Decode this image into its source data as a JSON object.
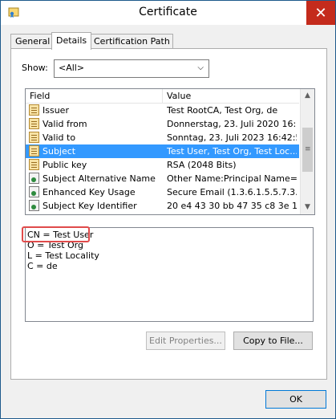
{
  "window": {
    "title": "Certificate",
    "close_glyph": "✕"
  },
  "tabs": [
    {
      "label": "General"
    },
    {
      "label": "Details"
    },
    {
      "label": "Certification Path"
    }
  ],
  "details": {
    "show_label": "Show:",
    "show_value": "<All>",
    "columns": {
      "field": "Field",
      "value": "Value"
    },
    "rows": [
      {
        "field": "Issuer",
        "value": "Test RootCA, Test Org, de",
        "icon": "certificate-field-icon"
      },
      {
        "field": "Valid from",
        "value": "Donnerstag, 23. Juli 2020 16:...",
        "icon": "certificate-field-icon"
      },
      {
        "field": "Valid to",
        "value": "Sonntag, 23. Juli 2023 16:42:56",
        "icon": "certificate-field-icon"
      },
      {
        "field": "Subject",
        "value": "Test User, Test Org, Test Loc...",
        "icon": "certificate-field-icon",
        "selected": true
      },
      {
        "field": "Public key",
        "value": "RSA (2048 Bits)",
        "icon": "certificate-field-icon"
      },
      {
        "field": "Subject Alternative Name",
        "value": "Other Name:Principal Name=t...",
        "icon": "extension-icon"
      },
      {
        "field": "Enhanced Key Usage",
        "value": "Secure Email (1.3.6.1.5.5.7.3....",
        "icon": "extension-icon"
      },
      {
        "field": "Subject Key Identifier",
        "value": "20 e4 43 30 bb 47 35 c8 3e 17...",
        "icon": "extension-icon"
      }
    ],
    "detail_lines": [
      "CN = Test User",
      "O = Test Org",
      "L = Test Locality",
      "C = de"
    ],
    "edit_properties_label": "Edit Properties...",
    "copy_to_file_label": "Copy to File..."
  },
  "ok_label": "OK",
  "colors": {
    "selection": "#3399ff",
    "close_button": "#c42b1c",
    "highlight_box": "#e04b4b"
  }
}
